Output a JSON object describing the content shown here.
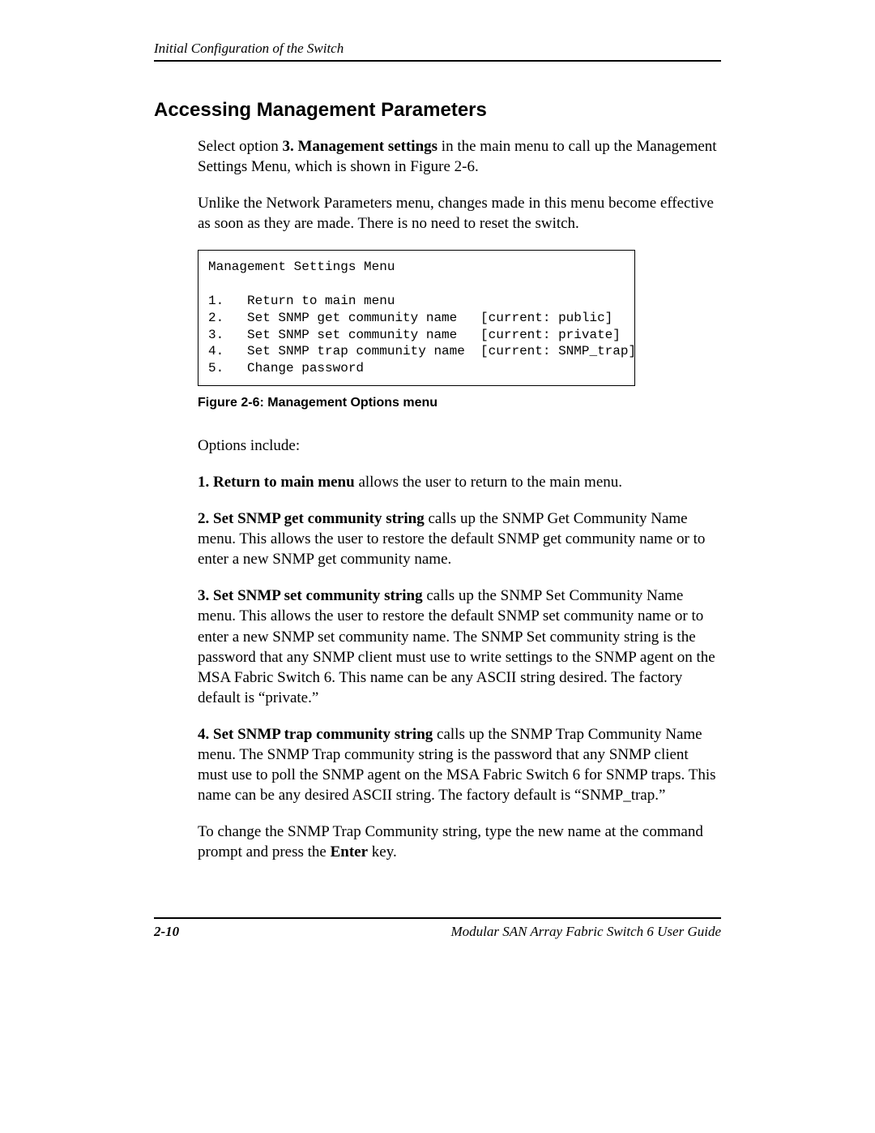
{
  "header": {
    "running_head": "Initial Configuration of the Switch"
  },
  "section": {
    "title": "Accessing Management Parameters"
  },
  "intro": {
    "p1_pre": "Select option ",
    "p1_bold": "3. Management settings",
    "p1_post": " in the main menu to call up the Management Settings Menu, which is shown in Figure 2-6.",
    "p2": "Unlike the Network Parameters menu, changes made in this menu become effective as soon as they are made. There is no need to reset the switch."
  },
  "menu": {
    "title": "Management Settings Menu",
    "lines": [
      "1.   Return to main menu",
      "2.   Set SNMP get community name   [current: public]",
      "3.   Set SNMP set community name   [current: private]",
      "4.   Set SNMP trap community name  [current: SNMP_trap]",
      "5.   Change password"
    ]
  },
  "figure": {
    "caption": "Figure 2-6:  Management Options menu"
  },
  "options": {
    "lead": "Options include:",
    "o1_bold": "1. Return to main menu",
    "o1_rest": " allows the user to return to the main menu.",
    "o2_bold": "2. Set SNMP get community string",
    "o2_rest": " calls up the SNMP Get Community Name menu. This allows the user to restore the default SNMP get community name or to enter a new SNMP get community name.",
    "o3_bold": "3. Set SNMP set community string",
    "o3_rest": " calls up the SNMP Set Community Name menu. This allows the user to restore the default SNMP set community name or to enter a new SNMP set community name. The SNMP Set community string is the password that any SNMP client must use to write settings to the SNMP agent on the MSA Fabric Switch 6. This name can be any ASCII string desired. The factory default is “private.”",
    "o4_bold": "4. Set SNMP trap community string",
    "o4_rest": " calls up the SNMP Trap Community Name menu. The SNMP Trap community string is the password that any SNMP client must use to poll the SNMP agent on the MSA Fabric Switch 6 for SNMP traps. This name can be any desired ASCII string. The factory default is “SNMP_trap.”",
    "p_change_pre": "To change the SNMP Trap Community string, type the new name at the command prompt and press the ",
    "p_change_bold": "Enter",
    "p_change_post": " key."
  },
  "footer": {
    "page_num": "2-10",
    "doc_title": "Modular SAN Array Fabric Switch 6 User Guide"
  }
}
